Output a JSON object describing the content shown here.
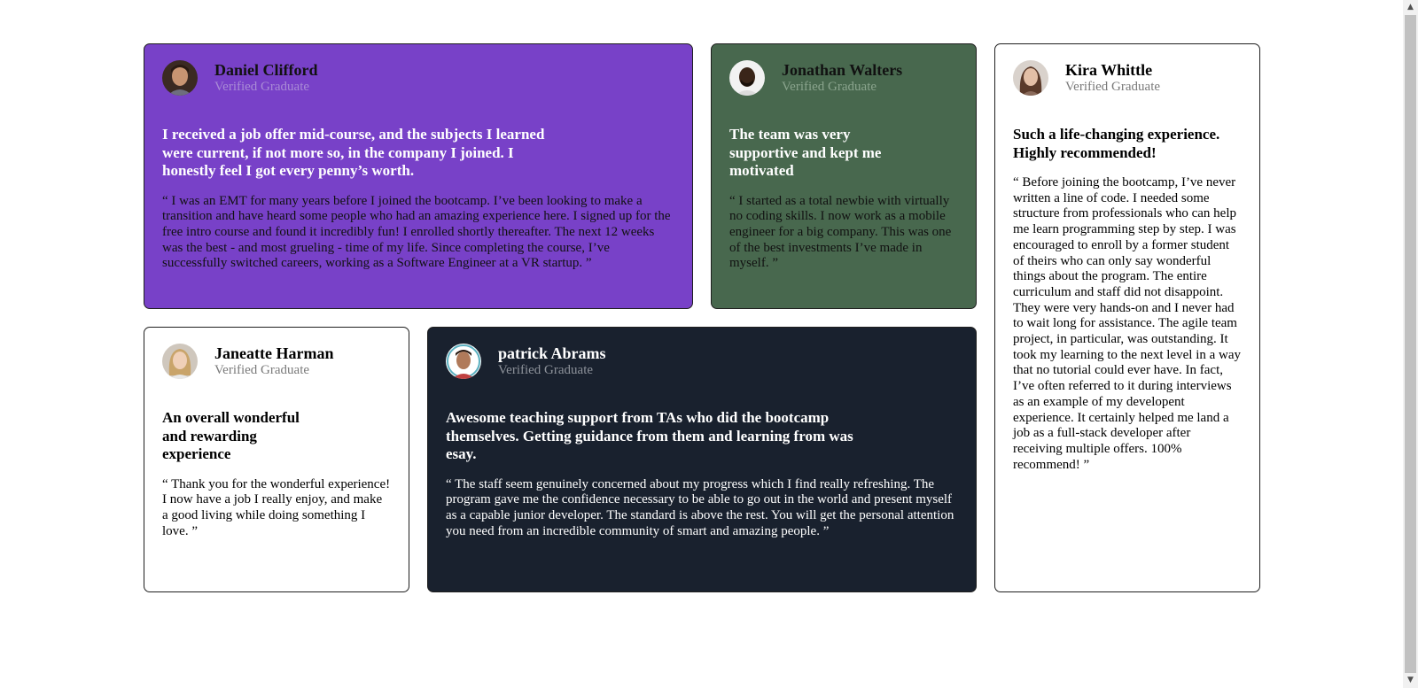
{
  "testimonials": [
    {
      "name": "Daniel Clifford",
      "role": "Verified Graduate",
      "headline": "I received a job offer mid-course, and the subjects I learned were current, if not more so, in the company I joined. I honestly feel I got every penny’s worth.",
      "quote": "“ I was an EMT for many years before I joined the bootcamp. I’ve been looking to make a transition and have heard some people who had an amazing experience here. I signed up for the free intro course and found it incredibly fun! I enrolled shortly thereafter. The next 12 weeks was the best - and most grueling - time of my life. Since completing the course, I’ve successfully switched careers, working as a Software Engineer at a VR startup. ”",
      "card_color": "#7841c8"
    },
    {
      "name": "Jonathan Walters",
      "role": "Verified Graduate",
      "headline": "The team was very supportive and kept me motivated",
      "quote": "“ I started as a total newbie with virtually no coding skills. I now work as a mobile engineer for a big company. This was one of the best investments I’ve made in myself. ”",
      "card_color": "#48684e"
    },
    {
      "name": "Kira Whittle",
      "role": "Verified Graduate",
      "headline": "Such a life-changing experience. Highly recommended!",
      "quote": "“ Before joining the bootcamp, I’ve never written a line of code. I needed some structure from professionals who can help me learn programming step by step. I was encouraged to enroll by a former student of theirs who can only say wonderful things about the program. The entire curriculum and staff did not disappoint. They were very hands-on and I never had to wait long for assistance. The agile team project, in particular, was outstanding. It took my learning to the next level in a way that no tutorial could ever have. In fact, I’ve often referred to it during interviews as an example of my developent experience. It certainly helped me land a job as a full-stack developer after receiving multiple offers. 100% recommend! ”",
      "card_color": "#ffffff"
    },
    {
      "name": "Janeatte Harman",
      "role": "Verified Graduate",
      "headline": "An overall wonderful and rewarding experience",
      "quote": "“ Thank you for the wonderful experience! I now have a job I really enjoy, and make a good living while doing something I love. ”",
      "card_color": "#ffffff"
    },
    {
      "name": "patrick Abrams",
      "role": "Verified Graduate",
      "headline": "Awesome teaching support from TAs who did the bootcamp themselves. Getting guidance from them and learning from was esay.",
      "quote": "“ The staff seem genuinely concerned about my progress which I find really refreshing. The program gave me the confidence necessary to be able to go out in the world and present myself as a capable junior developer. The standard is above the rest. You will get the personal attention you need from an incredible community of smart and amazing people. ”",
      "card_color": "#19212e"
    }
  ],
  "scrollbar": {
    "up_icon": "triangle-up-icon",
    "down_icon": "triangle-down-icon"
  }
}
